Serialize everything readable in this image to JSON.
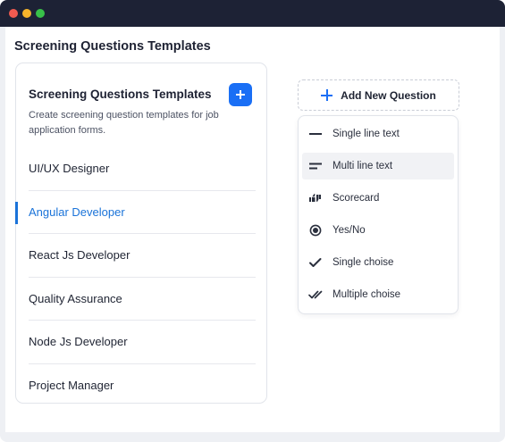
{
  "page": {
    "title": "Screening Questions Templates"
  },
  "card": {
    "title": "Screening Questions Templates",
    "description": "Create screening question templates for job application forms.",
    "add_button_icon": "plus-icon",
    "items": [
      {
        "label": "UI/UX Designer",
        "active": false
      },
      {
        "label": "Angular Developer",
        "active": true
      },
      {
        "label": "React Js Developer",
        "active": false
      },
      {
        "label": "Quality Assurance",
        "active": false
      },
      {
        "label": "Node Js Developer",
        "active": false
      },
      {
        "label": "Project Manager",
        "active": false
      }
    ]
  },
  "add_question": {
    "label": "Add New Question",
    "icon": "plus-icon"
  },
  "question_types": [
    {
      "label": "Single line text",
      "icon": "single-line-icon"
    },
    {
      "label": "Multi line text",
      "icon": "multi-line-icon",
      "highlighted": true
    },
    {
      "label": "Scorecard",
      "icon": "thumbs-icon"
    },
    {
      "label": "Yes/No",
      "icon": "radio-icon"
    },
    {
      "label": "Single choise",
      "icon": "check-icon"
    },
    {
      "label": "Multiple choise",
      "icon": "double-check-icon"
    }
  ],
  "colors": {
    "accent": "#1a6ff5",
    "active_text": "#1a73d9",
    "titlebar": "#1d2235"
  }
}
